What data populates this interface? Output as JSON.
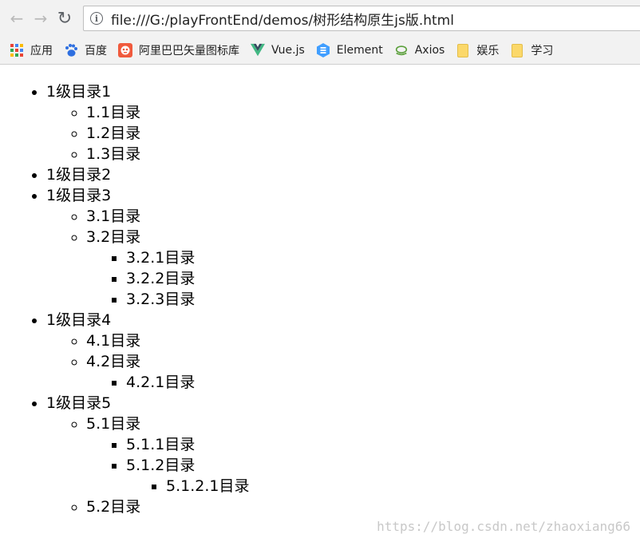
{
  "browser": {
    "url": "file:///G:/playFrontEnd/demos/树形结构原生js版.html",
    "nav": {
      "back_glyph": "←",
      "forward_glyph": "→",
      "reload_glyph": "↻",
      "info_glyph": "i"
    }
  },
  "bookmarks": [
    {
      "label": "应用",
      "icon": "apps-grid-icon"
    },
    {
      "label": "百度",
      "icon": "baidu-paw-icon"
    },
    {
      "label": "阿里巴巴矢量图标库",
      "icon": "iconfont-icon"
    },
    {
      "label": "Vue.js",
      "icon": "vue-logo-icon"
    },
    {
      "label": "Element",
      "icon": "element-logo-icon"
    },
    {
      "label": "Axios",
      "icon": "axios-logo-icon"
    },
    {
      "label": "娱乐",
      "icon": "folder-icon"
    },
    {
      "label": "学习",
      "icon": "folder-icon"
    }
  ],
  "colors": {
    "chrome_bg": "#f2f2f2",
    "baidu": "#2e6fe0",
    "iconfont": "#f05a3d",
    "vue_green": "#41b883",
    "vue_dark": "#35495e",
    "element_blue": "#409eff",
    "axios_green": "#5a9f3a",
    "folder": "#fbd86a"
  },
  "tree": [
    {
      "label": "1级目录1",
      "children": [
        {
          "label": "1.1目录"
        },
        {
          "label": "1.2目录"
        },
        {
          "label": "1.3目录"
        }
      ]
    },
    {
      "label": "1级目录2"
    },
    {
      "label": "1级目录3",
      "children": [
        {
          "label": "3.1目录"
        },
        {
          "label": "3.2目录",
          "children": [
            {
              "label": "3.2.1目录"
            },
            {
              "label": "3.2.2目录"
            },
            {
              "label": "3.2.3目录"
            }
          ]
        }
      ]
    },
    {
      "label": "1级目录4",
      "children": [
        {
          "label": "4.1目录"
        },
        {
          "label": "4.2目录",
          "children": [
            {
              "label": "4.2.1目录"
            }
          ]
        }
      ]
    },
    {
      "label": "1级目录5",
      "children": [
        {
          "label": "5.1目录",
          "children": [
            {
              "label": "5.1.1目录"
            },
            {
              "label": "5.1.2目录",
              "children": [
                {
                  "label": "5.1.2.1目录"
                }
              ]
            }
          ]
        },
        {
          "label": "5.2目录"
        }
      ]
    }
  ],
  "watermark": "https://blog.csdn.net/zhaoxiang66"
}
